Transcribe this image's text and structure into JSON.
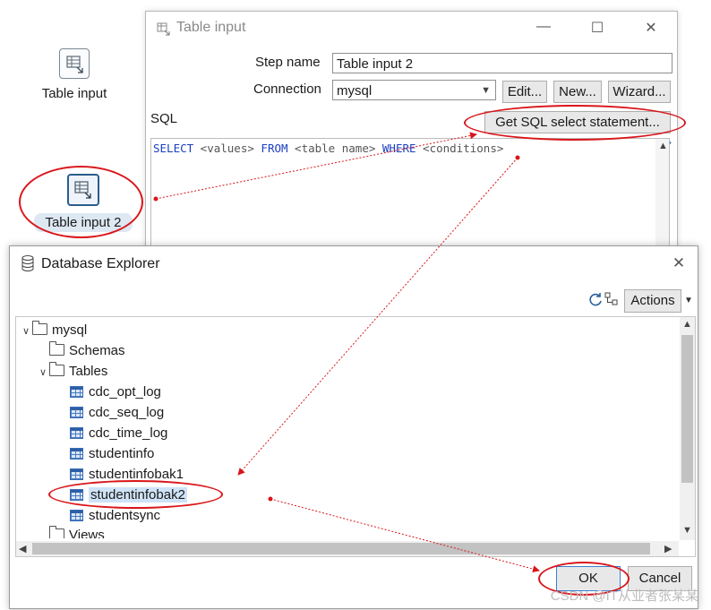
{
  "canvas": {
    "step1_label": "Table input",
    "step2_label": "Table input 2"
  },
  "table_input_dialog": {
    "title": "Table input",
    "step_name_label": "Step name",
    "step_name_value": "Table input 2",
    "connection_label": "Connection",
    "connection_value": "mysql",
    "edit_button": "Edit...",
    "new_button": "New...",
    "wizard_button": "Wizard...",
    "sql_label": "SQL",
    "get_sql_button": "Get SQL select statement...",
    "sql_text": {
      "kw1": "SELECT",
      "p1": " <values> ",
      "kw2": "FROM",
      "p2": " <table name> ",
      "kw3": "WHERE",
      "p3": " <conditions>"
    }
  },
  "database_explorer": {
    "title": "Database Explorer",
    "actions_button": "Actions",
    "tree": {
      "root": "mysql",
      "schemas": "Schemas",
      "tables": "Tables",
      "table_items": [
        "cdc_opt_log",
        "cdc_seq_log",
        "cdc_time_log",
        "studentinfo",
        "studentinfobak1",
        "studentinfobak2",
        "studentsync"
      ],
      "views": "Views"
    },
    "ok_button": "OK",
    "cancel_button": "Cancel"
  },
  "watermark": "CSDN @IT从业者张某某",
  "colors": {
    "annotation": "#d9161b",
    "selection": "#cfe3f7"
  }
}
